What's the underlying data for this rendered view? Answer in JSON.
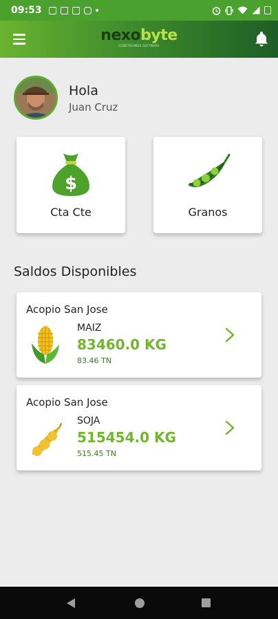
{
  "status_bar": {
    "time": "09:53",
    "notification_icons": [
      "facebook-icon",
      "mail-icon",
      "laptop-icon",
      "instagram-icon",
      "dot-icon"
    ],
    "system_icons": [
      "alarm-icon",
      "vibrate-icon",
      "wifi-icon",
      "signal-icon",
      "battery-icon"
    ]
  },
  "app_bar": {
    "logo_part1": "nexo",
    "logo_part2": "byte",
    "logo_tagline": "CONSTRUIMOS SOFTWARE",
    "menu_icon": "hamburger-icon",
    "notifications_icon": "bell-icon"
  },
  "greeting": {
    "hello": "Hola",
    "user_name": "Juan Cruz"
  },
  "tiles": [
    {
      "label": "Cta Cte",
      "icon": "money-bag-icon"
    },
    {
      "label": "Granos",
      "icon": "soybean-pod-icon"
    }
  ],
  "section_title": "Saldos Disponibles",
  "balances": [
    {
      "site": "Acopio San Jose",
      "grain": "MAIZ",
      "kg": "83460.0  KG",
      "tn": "83.46 TN",
      "icon": "corn-icon"
    },
    {
      "site": "Acopio San Jose",
      "grain": "SOJA",
      "kg": "515454.0  KG",
      "tn": "515.45 TN",
      "icon": "soybean-icon"
    }
  ],
  "colors": {
    "accent_green": "#72b62c",
    "status_bar": "#4aa12e",
    "appbar_dark": "#1e5e26"
  }
}
